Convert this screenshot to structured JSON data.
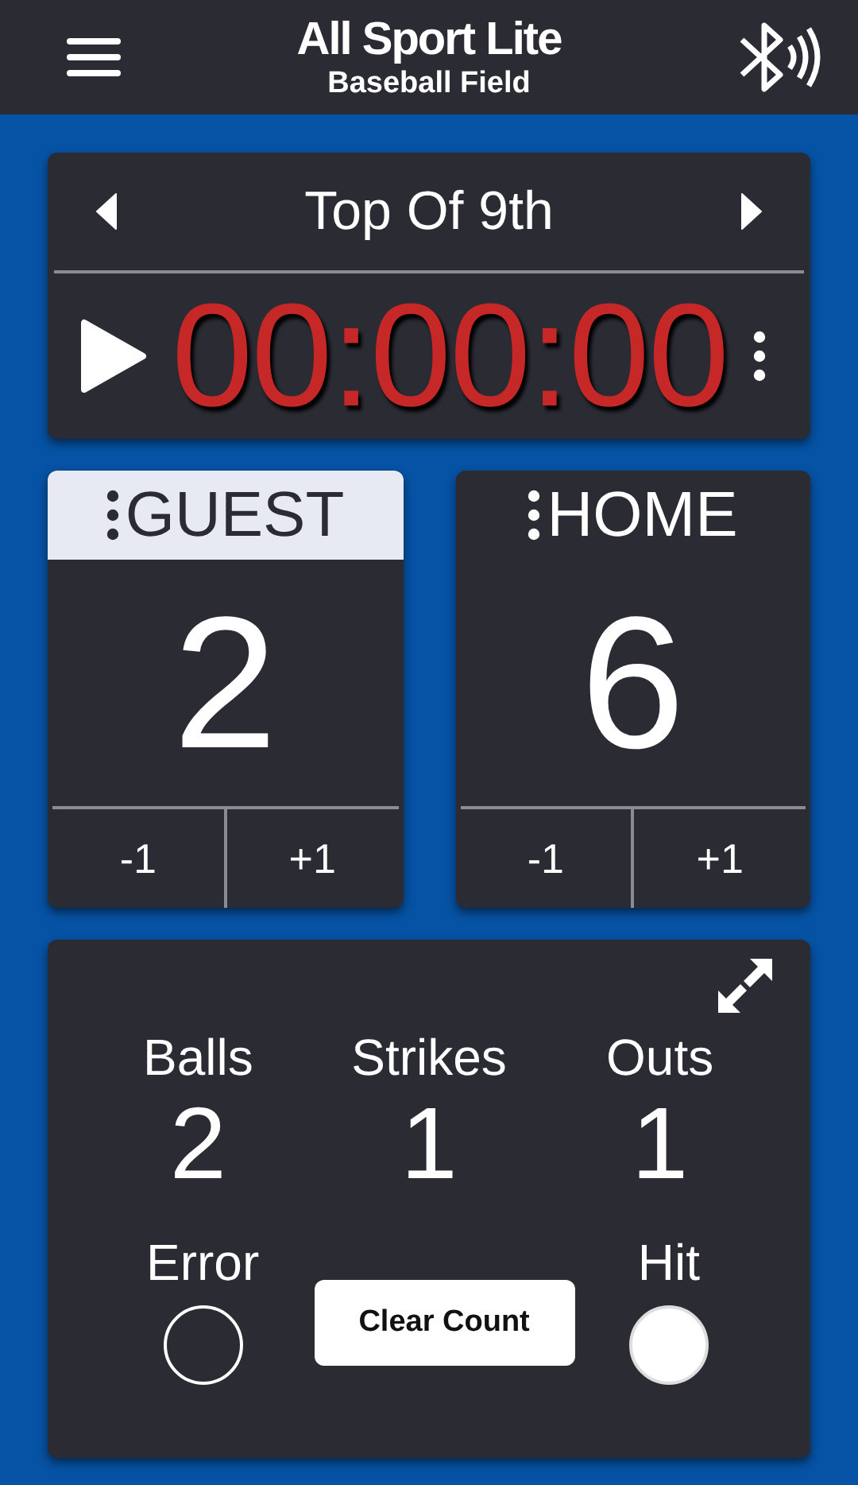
{
  "header": {
    "title": "All Sport Lite",
    "subtitle": "Baseball Field"
  },
  "period": {
    "label": "Top Of 9th"
  },
  "timer": {
    "time": "00:00:00",
    "running": false
  },
  "teams": [
    {
      "name": "GUEST",
      "score": "2",
      "selected": true,
      "minus": "-1",
      "plus": "+1"
    },
    {
      "name": "HOME",
      "score": "6",
      "selected": false,
      "minus": "-1",
      "plus": "+1"
    }
  ],
  "count": [
    {
      "label": "Balls",
      "value": "2"
    },
    {
      "label": "Strikes",
      "value": "1"
    },
    {
      "label": "Outs",
      "value": "1"
    }
  ],
  "indicators": [
    {
      "label": "Error",
      "on": false
    },
    {
      "label": "Hit",
      "on": true
    }
  ],
  "clear_button": "Clear Count"
}
